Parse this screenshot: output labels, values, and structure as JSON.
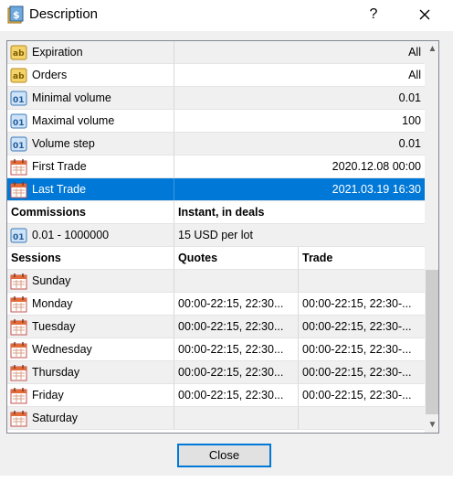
{
  "window": {
    "title": "Description",
    "help_label": "?"
  },
  "properties": [
    {
      "icon": "ab-text-icon",
      "name": "Expiration",
      "value": "All"
    },
    {
      "icon": "ab-text-icon",
      "name": "Orders",
      "value": "All"
    },
    {
      "icon": "numeric-01-icon",
      "name": "Minimal volume",
      "value": "0.01"
    },
    {
      "icon": "numeric-01-icon",
      "name": "Maximal volume",
      "value": "100"
    },
    {
      "icon": "numeric-01-icon",
      "name": "Volume step",
      "value": "0.01"
    },
    {
      "icon": "calendar-icon",
      "name": "First Trade",
      "value": "2020.12.08 00:00"
    },
    {
      "icon": "calendar-icon",
      "name": "Last Trade",
      "value": "2021.03.19 16:30",
      "selected": true
    }
  ],
  "commissions": {
    "header": {
      "col1": "Commissions",
      "col2": "Instant, in deals"
    },
    "rows": [
      {
        "icon": "numeric-01-icon",
        "range": "0.01 - 1000000",
        "fee": "15 USD per lot"
      }
    ]
  },
  "sessions": {
    "header": {
      "col1": "Sessions",
      "col2": "Quotes",
      "col3": "Trade"
    },
    "days": [
      {
        "day": "Sunday",
        "quotes": "",
        "trade": ""
      },
      {
        "day": "Monday",
        "quotes": "00:00-22:15, 22:30...",
        "trade": "00:00-22:15, 22:30-..."
      },
      {
        "day": "Tuesday",
        "quotes": "00:00-22:15, 22:30...",
        "trade": "00:00-22:15, 22:30-..."
      },
      {
        "day": "Wednesday",
        "quotes": "00:00-22:15, 22:30...",
        "trade": "00:00-22:15, 22:30-..."
      },
      {
        "day": "Thursday",
        "quotes": "00:00-22:15, 22:30...",
        "trade": "00:00-22:15, 22:30-..."
      },
      {
        "day": "Friday",
        "quotes": "00:00-22:15, 22:30...",
        "trade": "00:00-22:15, 22:30-..."
      },
      {
        "day": "Saturday",
        "quotes": "",
        "trade": ""
      }
    ]
  },
  "buttons": {
    "close": "Close"
  },
  "colors": {
    "selection": "#0078d7",
    "row_gray": "#f0f0f0",
    "row_white": "#ffffff"
  }
}
